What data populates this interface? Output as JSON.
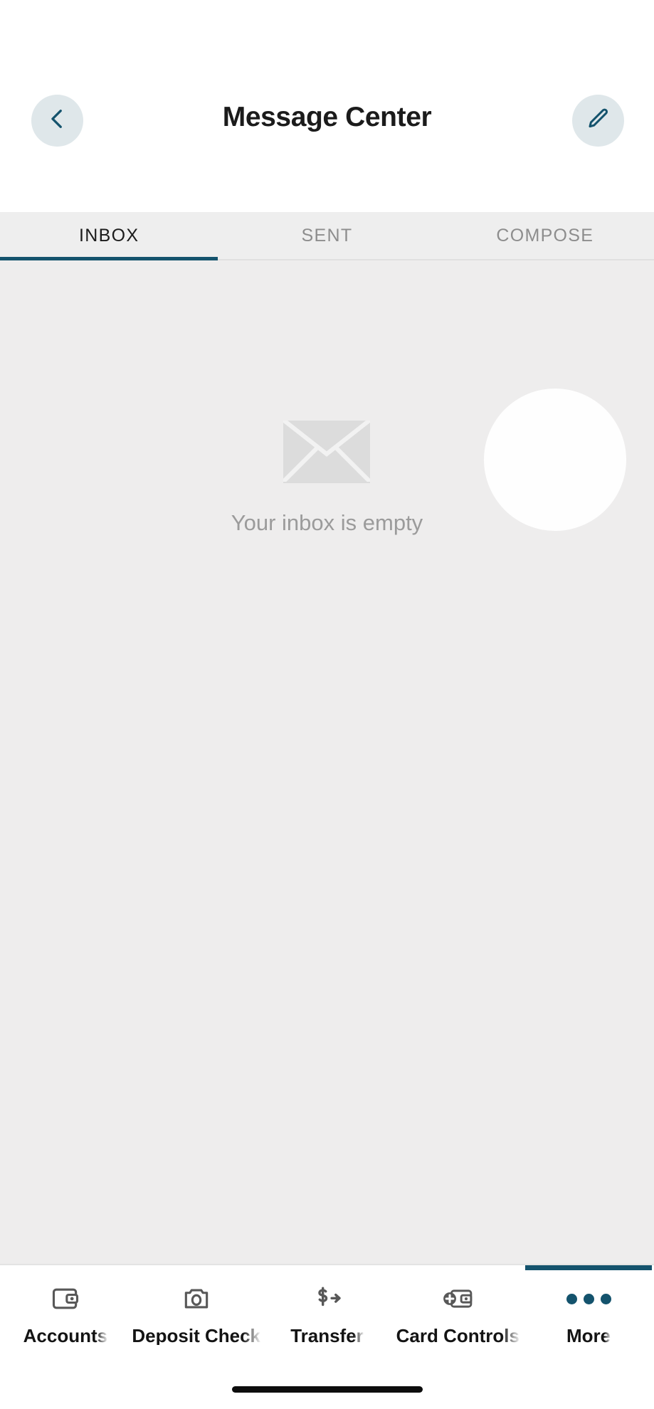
{
  "header": {
    "title": "Message Center",
    "back_icon": "chevron-left-icon",
    "compose_icon": "pencil-edit-icon",
    "accent_color": "#14536d",
    "circle_bg_color": "#dfe7ea"
  },
  "tabs": {
    "items": [
      {
        "label": "INBOX",
        "active": true
      },
      {
        "label": "SENT",
        "active": false
      },
      {
        "label": "COMPOSE",
        "active": false
      }
    ],
    "indicator_color": "#14536d",
    "bar_bg_color": "#eeeeee"
  },
  "content": {
    "empty_state": {
      "icon": "envelope-icon",
      "message": "Your inbox is empty",
      "icon_color": "#dcdcdc",
      "text_color": "#9b9b9b"
    },
    "bg_color": "#eeeded"
  },
  "coachmark": {
    "name": "compose-spotlight-highlight",
    "visible": true
  },
  "bottom_nav": {
    "items": [
      {
        "label": "Accounts",
        "icon": "wallet-icon",
        "active": false
      },
      {
        "label": "Deposit Check",
        "icon": "camera-icon",
        "active": false
      },
      {
        "label": "Transfer",
        "icon": "dollar-arrow-icon",
        "active": false
      },
      {
        "label": "Card Controls",
        "icon": "card-plus-icon",
        "active": false
      },
      {
        "label": "More",
        "icon": "ellipsis-icon",
        "active": true
      }
    ],
    "active_color": "#14536d",
    "icon_color": "#585858",
    "label_color": "#141414"
  },
  "system": {
    "home_indicator": "home-indicator-bar"
  }
}
